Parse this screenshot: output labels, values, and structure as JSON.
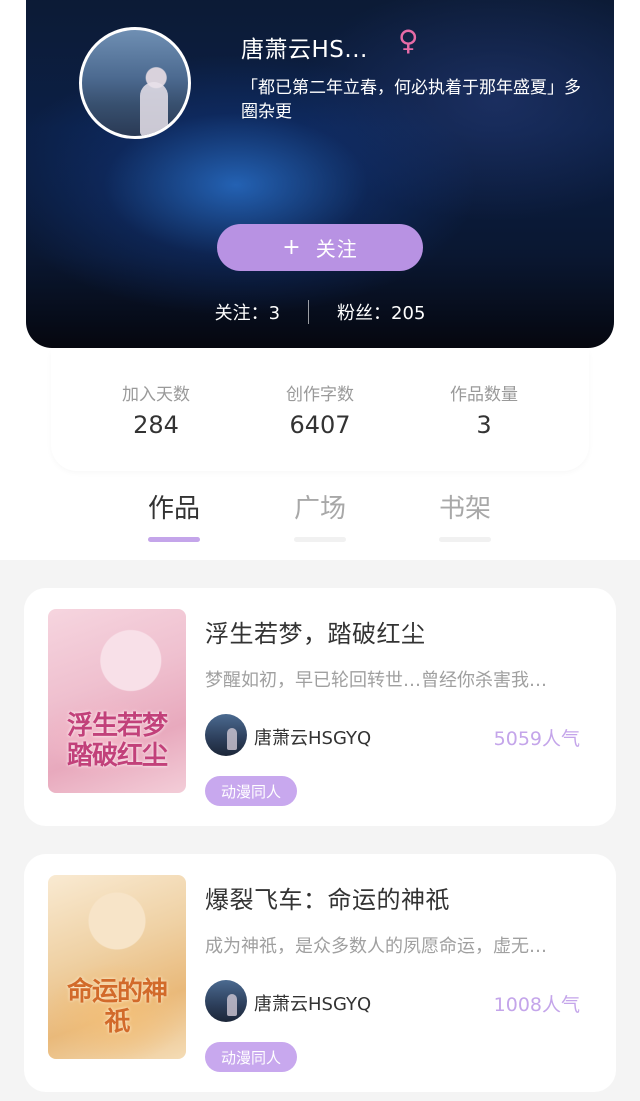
{
  "profile": {
    "username": "唐萧云HS...",
    "gender_symbol": "♀",
    "bio": "「都已第二年立春，何必执着于那年盛夏」多圈杂更",
    "follow_button": {
      "plus": "+",
      "label": "关注"
    },
    "following": "关注：3",
    "fans": "粉丝：205"
  },
  "stats": [
    {
      "label": "加入天数",
      "value": "284"
    },
    {
      "label": "创作字数",
      "value": "6407"
    },
    {
      "label": "作品数量",
      "value": "3"
    }
  ],
  "tabs": [
    {
      "label": "作品",
      "active": true
    },
    {
      "label": "广场",
      "active": false
    },
    {
      "label": "书架",
      "active": false
    }
  ],
  "books": [
    {
      "title": "浮生若梦，踏破红尘",
      "desc": "梦醒如初，早已轮回转世…曾经你杀害我…",
      "author": "唐萧云HSGYQ",
      "popularity": "5059人气",
      "tag": "动漫同人",
      "cover_text": "浮生若梦踏破红尘"
    },
    {
      "title": "爆裂飞车：命运的神祇",
      "desc": "成为神祇，是众多数人的夙愿命运，虚无…",
      "author": "唐萧云HSGYQ",
      "popularity": "1008人气",
      "tag": "动漫同人",
      "cover_text": "命运的神祇"
    }
  ],
  "colors": {
    "accent": "#b892e3",
    "tag": "#c8a8ee",
    "popularity": "#c4a5ea",
    "gender": "#e66ba7"
  }
}
